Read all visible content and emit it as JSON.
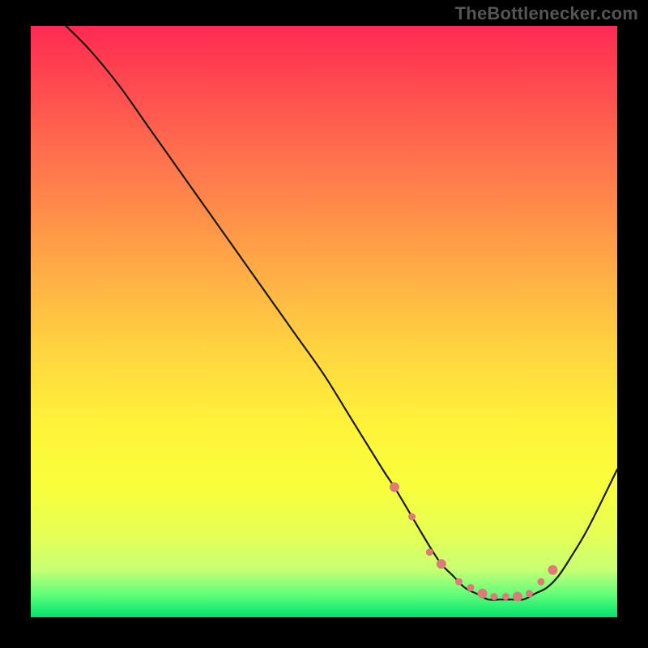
{
  "attribution": "TheBottlenecker.com",
  "colors": {
    "page_bg": "#000000",
    "attribution_text": "#555555",
    "curve_stroke": "#1a1a0a",
    "dot_fill": "#e07a7a",
    "gradient_top": "#ff2a54",
    "gradient_bottom": "#00e26d"
  },
  "chart_data": {
    "type": "line",
    "title": "",
    "xlabel": "",
    "ylabel": "",
    "xlim": [
      0,
      100
    ],
    "ylim": [
      0,
      100
    ],
    "grid": false,
    "legend": false,
    "series": [
      {
        "name": "bottleneck-curve",
        "x": [
          6,
          10,
          15,
          20,
          25,
          30,
          35,
          40,
          45,
          50,
          55,
          60,
          62,
          65,
          68,
          70,
          72,
          74,
          76,
          78,
          80,
          82,
          84,
          86,
          88,
          90,
          92,
          95,
          100
        ],
        "values": [
          100,
          96,
          90,
          83,
          76,
          69,
          62,
          55,
          48,
          41,
          33,
          25,
          22,
          17,
          12,
          9,
          7,
          5,
          4,
          3,
          3,
          3,
          3,
          4,
          5,
          7,
          10,
          15,
          25
        ]
      }
    ],
    "highlight_points": {
      "comment": "salmon dots near curve minimum",
      "x": [
        62,
        65,
        68,
        70,
        73,
        75,
        77,
        79,
        81,
        83,
        85,
        87,
        89
      ],
      "values": [
        22,
        17,
        11,
        9,
        6,
        5,
        4,
        3.5,
        3.5,
        3.5,
        4,
        6,
        8
      ]
    }
  }
}
